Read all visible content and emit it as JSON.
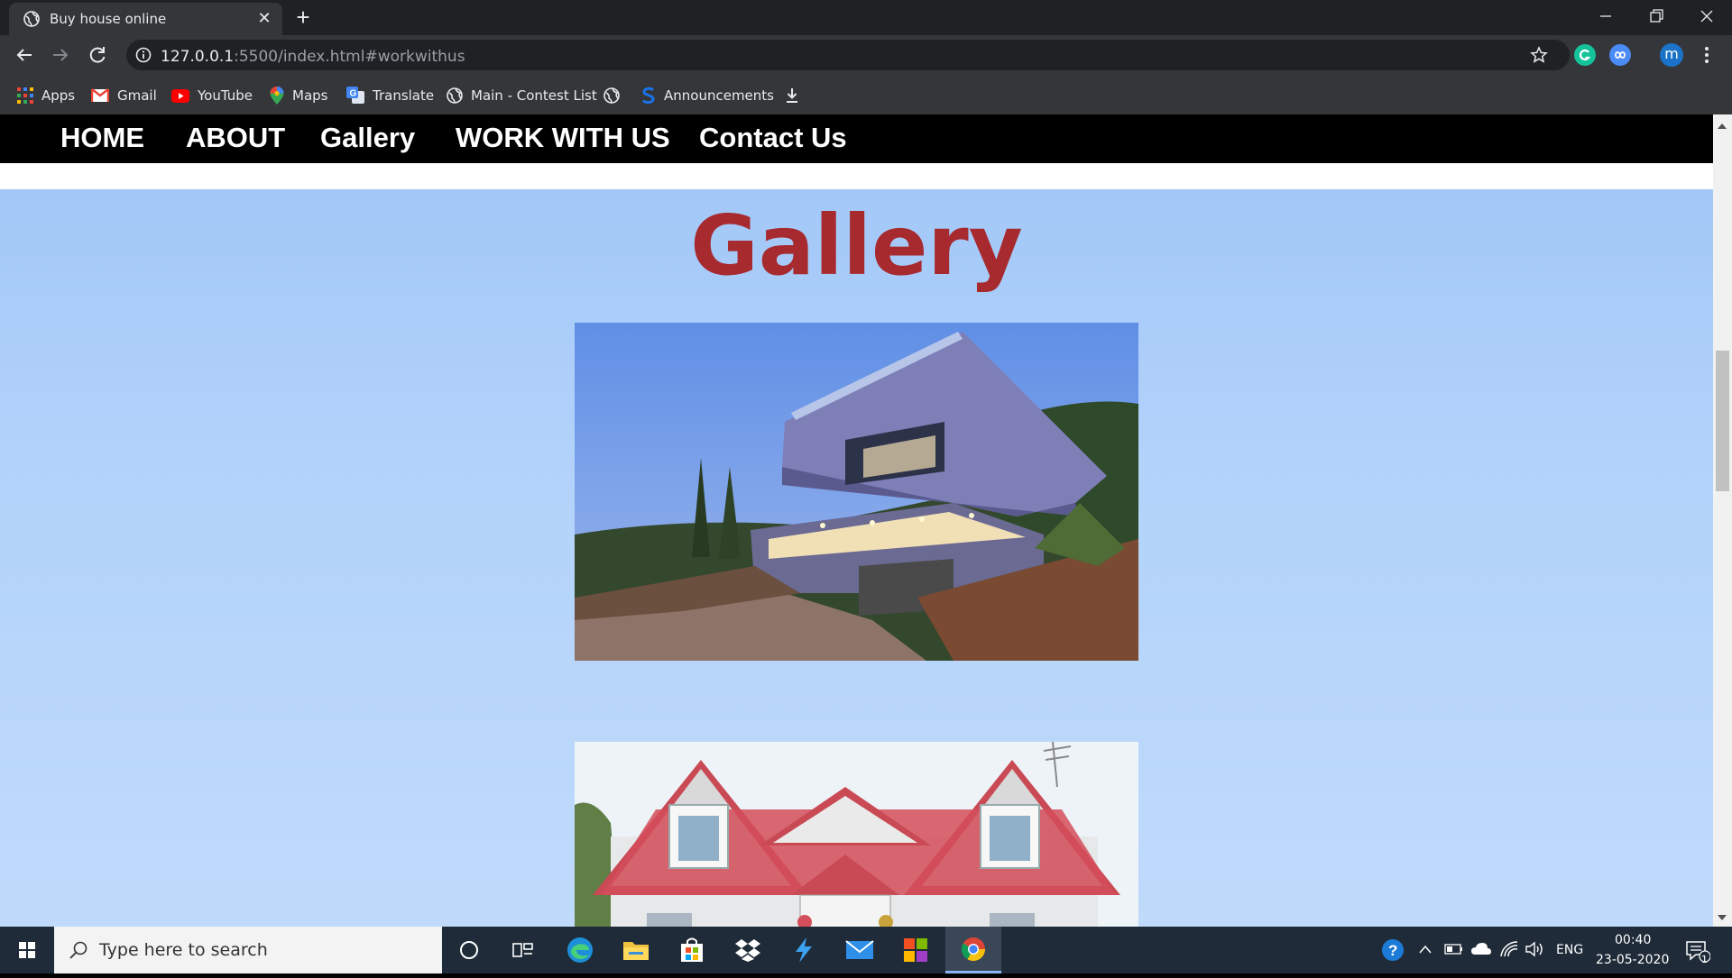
{
  "browser": {
    "tab_title": "Buy house online",
    "url_host": "127.0.0.1",
    "url_rest": ":5500/index.html#workwithus",
    "profile_initial": "m"
  },
  "bookmarks": [
    {
      "label": "Apps",
      "icon": "apps-grid-icon"
    },
    {
      "label": "Gmail",
      "icon": "gmail-icon"
    },
    {
      "label": "YouTube",
      "icon": "youtube-icon"
    },
    {
      "label": "Maps",
      "icon": "maps-pin-icon"
    },
    {
      "label": "Translate",
      "icon": "translate-icon"
    },
    {
      "label": "Main - Contest List",
      "icon": "globe-icon"
    },
    {
      "label": "",
      "icon": "globe-icon"
    },
    {
      "label": "Announcements",
      "icon": "s-logo-icon"
    },
    {
      "label": "",
      "icon": "download-icon"
    }
  ],
  "site_nav": [
    "HOME",
    "ABOUT",
    "Gallery",
    "WORK WITH US",
    "Contact Us"
  ],
  "gallery": {
    "title": "Gallery",
    "images": [
      "modern-house-photo",
      "red-roof-house-photo"
    ]
  },
  "taskbar": {
    "search_placeholder": "Type here to search",
    "language": "ENG",
    "time": "00:40",
    "date": "23-05-2020",
    "notification_count": "1"
  },
  "colors": {
    "accent_title": "#a72a2f",
    "page_background": "#b3d3fa",
    "nav_background": "#000000"
  }
}
